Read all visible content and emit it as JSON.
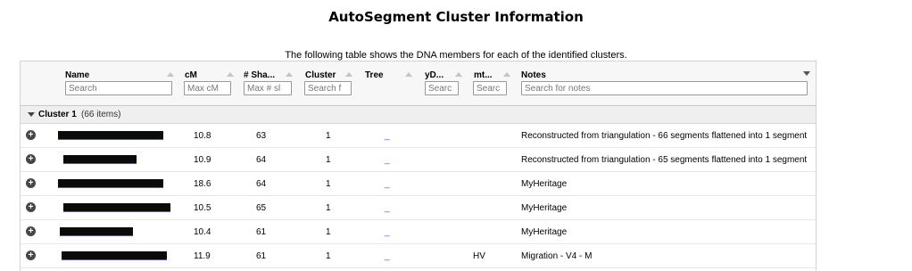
{
  "page": {
    "title": "AutoSegment Cluster Information",
    "subtitle": "The following table shows the DNA members for each of the identified clusters."
  },
  "columns": {
    "name": {
      "label": "Name",
      "placeholder": "Search"
    },
    "cm": {
      "label": "cM",
      "placeholder": "Max cM"
    },
    "shared": {
      "label": "# Sha...",
      "placeholder": "Max # sl"
    },
    "cluster": {
      "label": "Cluster",
      "placeholder": "Search f"
    },
    "tree": {
      "label": "Tree"
    },
    "ydna": {
      "label": "yD...",
      "placeholder": "Searc"
    },
    "mtdna": {
      "label": "mt...",
      "placeholder": "Searc"
    },
    "notes": {
      "label": "Notes",
      "placeholder": "Search for notes"
    }
  },
  "group": {
    "name": "Cluster 1",
    "count": "(66 items)"
  },
  "rows": [
    {
      "cm": "10.8",
      "shared": "63",
      "cluster": "1",
      "tree": "_",
      "mt": "",
      "notes": "Reconstructed from triangulation - 66 segments flattened into 1 segment"
    },
    {
      "cm": "10.9",
      "shared": "64",
      "cluster": "1",
      "tree": "_",
      "mt": "",
      "notes": "Reconstructed from triangulation - 65 segments flattened into 1 segment"
    },
    {
      "cm": "18.6",
      "shared": "64",
      "cluster": "1",
      "tree": "_",
      "mt": "",
      "notes": "MyHeritage"
    },
    {
      "cm": "10.5",
      "shared": "65",
      "cluster": "1",
      "tree": "_",
      "mt": "",
      "notes": "MyHeritage"
    },
    {
      "cm": "10.4",
      "shared": "61",
      "cluster": "1",
      "tree": "_",
      "mt": "",
      "notes": "MyHeritage"
    },
    {
      "cm": "11.9",
      "shared": "61",
      "cluster": "1",
      "tree": "_",
      "mt": "HV",
      "notes": "Migration - V4 - M"
    }
  ],
  "icons": {
    "expand": "plus-circle-icon",
    "collapse": "triangle-down-icon",
    "sort": "sort-arrow-icon"
  }
}
